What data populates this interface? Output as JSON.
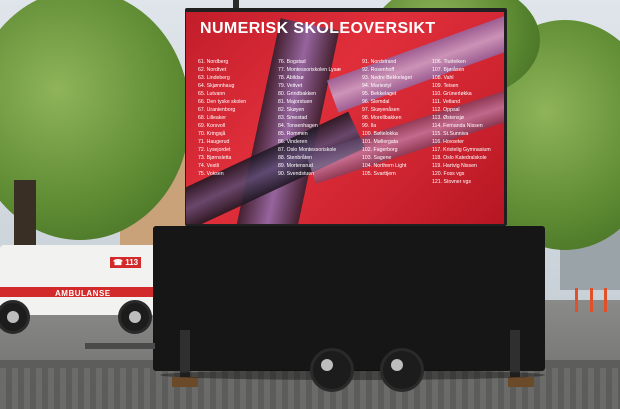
{
  "screen": {
    "title": "NUMERISK SKOLEOVERSIKT",
    "columns": [
      [
        "61. Nordberg",
        "62. Nordtvet",
        "63. Lindeberg",
        "64. Skjønnhaug",
        "65. Lutvann",
        "66. Den tyske skolen",
        "67. Uranienborg",
        "68. Lilleaker",
        "69. Korsvoll",
        "70. Kringsjå",
        "71. Haugerud",
        "72. Lysejordet",
        "73. Bjørnsletta",
        "74. Vestli",
        "75. Voksen"
      ],
      [
        "76. Bogstad",
        "77. Montessoriskolen Lysæ",
        "78. Abildsø",
        "79. Veitvet",
        "80. Grindbakken",
        "81. Majorstuen",
        "82. Skøyen",
        "83. Smestad",
        "84. Tonsenhagen",
        "85. Rommen",
        "86. Vinderen",
        "87. Oslo Montessoriskole",
        "88. Stenbråten",
        "89. Mortensrud",
        "90. Svendstuen"
      ],
      [
        "91. Nordstrand",
        "92. Rosenhoff",
        "93. Nedre Bekkelaget",
        "94. Mariestyl",
        "95. Bekkelaget",
        "96. Slemdal",
        "97. Skøyenåsen",
        "98. Morellbakken",
        "99. Ila",
        "100. Bøltelokka",
        "101. Møllergata",
        "102. Fagerborg",
        "103. Sagene",
        "104. Northern Light",
        "105. Svarttjern"
      ],
      [
        "106. Tiurleiken",
        "107. Bjøråsen",
        "108. Vahl",
        "109. Teisen",
        "110. Grünerløkka",
        "111. Vetland",
        "112. Oppsal",
        "113. Østensjø",
        "114. Fernanda Nissen",
        "115. St.Sunniva",
        "116. Hovseter",
        "117. Kristelig Gymnasium",
        "118. Oslo Katedralskole",
        "119. Hartvig Nissen",
        "120. Foss vgs",
        "121. Stovner vgs"
      ]
    ]
  },
  "ambulance": {
    "label": "AMBULANSE",
    "phone": "☎ 113"
  },
  "colors": {
    "screen_red": "#d42532",
    "swirl_purple": "#8a6fb0",
    "swirl_dark": "#2a1e2e",
    "trailer": "#161616"
  }
}
